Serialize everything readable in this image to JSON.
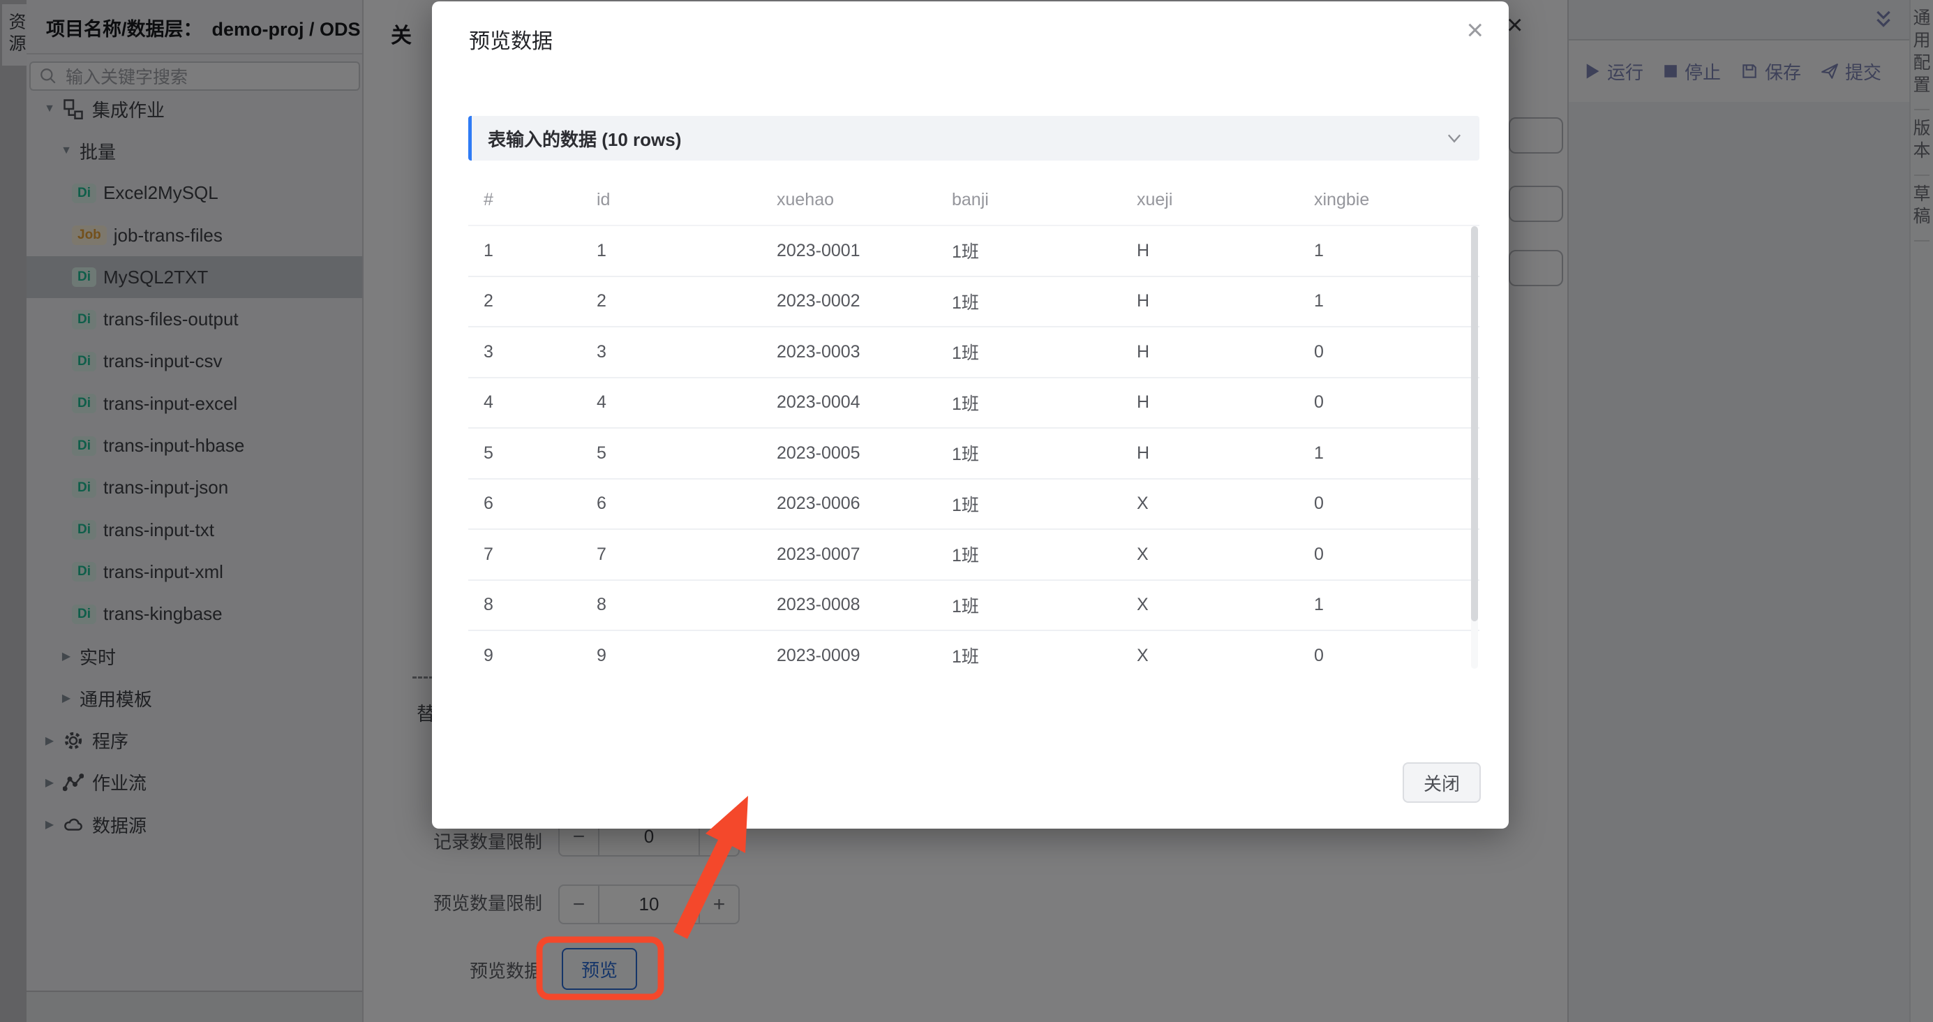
{
  "activity_bar": {
    "active_tab": "资源"
  },
  "sidebar": {
    "title_label": "项目名称/数据层：",
    "title_value": "demo-proj / ODS",
    "search_placeholder": "输入关键字搜索",
    "tree": [
      {
        "label": "集成作业",
        "indent": 0,
        "caret": "down",
        "icon": "sitemap"
      },
      {
        "label": "批量",
        "indent": 1,
        "caret": "down"
      },
      {
        "label": "Excel2MySQL",
        "indent": 2,
        "badge": "Di"
      },
      {
        "label": "job-trans-files",
        "indent": 2,
        "badge": "Job"
      },
      {
        "label": "MySQL2TXT",
        "indent": 2,
        "badge": "Di",
        "selected": true
      },
      {
        "label": "trans-files-output",
        "indent": 2,
        "badge": "Di"
      },
      {
        "label": "trans-input-csv",
        "indent": 2,
        "badge": "Di"
      },
      {
        "label": "trans-input-excel",
        "indent": 2,
        "badge": "Di"
      },
      {
        "label": "trans-input-hbase",
        "indent": 2,
        "badge": "Di"
      },
      {
        "label": "trans-input-json",
        "indent": 2,
        "badge": "Di"
      },
      {
        "label": "trans-input-txt",
        "indent": 2,
        "badge": "Di"
      },
      {
        "label": "trans-input-xml",
        "indent": 2,
        "badge": "Di"
      },
      {
        "label": "trans-kingbase",
        "indent": 2,
        "badge": "Di"
      },
      {
        "label": "实时",
        "indent": 1,
        "caret": "right"
      },
      {
        "label": "通用模板",
        "indent": 1,
        "caret": "right"
      },
      {
        "label": "程序",
        "indent": 0,
        "caret": "right",
        "icon": "gear"
      },
      {
        "label": "作业流",
        "indent": 0,
        "caret": "right",
        "icon": "flow"
      },
      {
        "label": "数据源",
        "indent": 0,
        "caret": "right",
        "icon": "cloud"
      }
    ]
  },
  "drawer": {
    "partial_title": "关",
    "partial_label": "替",
    "close_glyph": "×",
    "fields": [
      {
        "label": "记录数量限制",
        "value": "0"
      },
      {
        "label": "预览数量限制",
        "value": "10"
      }
    ],
    "stepper_minus": "−",
    "stepper_plus": "+",
    "preview_field_label": "预览数据",
    "preview_button": "预览"
  },
  "toolbar": {
    "run": "运行",
    "stop": "停止",
    "save": "保存",
    "submit": "提交"
  },
  "right_tabs": [
    "通用配置",
    "版本",
    "草稿"
  ],
  "modal": {
    "title": "预览数据",
    "close_glyph": "×",
    "collapse_header": "表输入的数据 (10 rows)",
    "close_button": "关闭",
    "table": {
      "columns": [
        "#",
        "id",
        "xuehao",
        "banji",
        "xueji",
        "xingbie"
      ],
      "rows": [
        [
          "1",
          "1",
          "2023-0001",
          "1班",
          "H",
          "1"
        ],
        [
          "2",
          "2",
          "2023-0002",
          "1班",
          "H",
          "1"
        ],
        [
          "3",
          "3",
          "2023-0003",
          "1班",
          "H",
          "0"
        ],
        [
          "4",
          "4",
          "2023-0004",
          "1班",
          "H",
          "0"
        ],
        [
          "5",
          "5",
          "2023-0005",
          "1班",
          "H",
          "1"
        ],
        [
          "6",
          "6",
          "2023-0006",
          "1班",
          "X",
          "0"
        ],
        [
          "7",
          "7",
          "2023-0007",
          "1班",
          "X",
          "0"
        ],
        [
          "8",
          "8",
          "2023-0008",
          "1班",
          "X",
          "1"
        ],
        [
          "9",
          "9",
          "2023-0009",
          "1班",
          "X",
          "0"
        ]
      ]
    }
  },
  "colors": {
    "accent_blue": "#2f7bf5",
    "annotation_red": "#f4482b",
    "di_badge": "#1fbf96",
    "job_badge": "#e8a23a"
  }
}
